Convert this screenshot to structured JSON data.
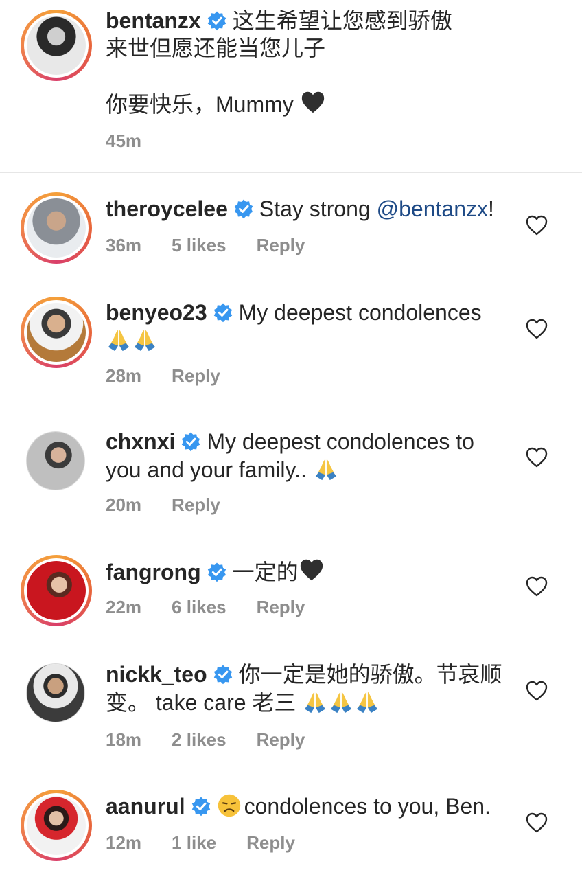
{
  "caption": {
    "username": "bentanzx",
    "line1": "这生希望让您感到骄傲",
    "line2": "来世但愿还能当您儿子",
    "line3": "你要快乐，Mummy",
    "time": "45m"
  },
  "comments": [
    {
      "username": "theroycelee",
      "text_before": "Stay strong ",
      "mention": "@bentanzx",
      "text_after": "!",
      "time": "36m",
      "likes": "5 likes",
      "reply": "Reply"
    },
    {
      "username": "benyeo23",
      "text": "My deepest condolences",
      "time": "28m",
      "reply": "Reply"
    },
    {
      "username": "chxnxi",
      "text": "My deepest condolences to you and your family..",
      "time": "20m",
      "reply": "Reply"
    },
    {
      "username": "fangrong",
      "text": "一定的",
      "time": "22m",
      "likes": "6 likes",
      "reply": "Reply"
    },
    {
      "username": "nickk_teo",
      "text": "你一定是她的骄傲。节哀顺变。 take care 老三",
      "time": "18m",
      "likes": "2 likes",
      "reply": "Reply"
    },
    {
      "username": "aanurul",
      "text": "condolences to you, Ben.",
      "time": "12m",
      "likes": "1 like",
      "reply": "Reply"
    }
  ],
  "icons": {
    "verified": "verified-badge-icon",
    "heart": "heart-outline-icon",
    "pray": "folded-hands-emoji",
    "black_heart": "black-heart-emoji",
    "sad": "disappointed-face-emoji"
  },
  "colors": {
    "verified": "#3897f0",
    "mention": "#1e4a86",
    "meta": "#8e8e8e"
  }
}
